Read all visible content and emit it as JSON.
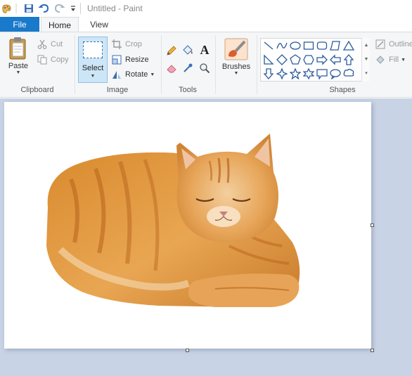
{
  "window": {
    "title": "Untitled - Paint"
  },
  "quick_access": {
    "icons": [
      "paint-app-icon",
      "save-icon",
      "undo-icon",
      "redo-icon",
      "customize-dropdown-icon"
    ]
  },
  "tabs": {
    "file": "File",
    "home": "Home",
    "view": "View"
  },
  "clipboard": {
    "paste": "Paste",
    "cut": "Cut",
    "copy": "Copy",
    "group_label": "Clipboard"
  },
  "image": {
    "select": "Select",
    "crop": "Crop",
    "resize": "Resize",
    "rotate": "Rotate",
    "group_label": "Image"
  },
  "tools": {
    "group_label": "Tools"
  },
  "brushes": {
    "label": "Brushes"
  },
  "shapes": {
    "group_label": "Shapes",
    "outline": "Outline",
    "fill": "Fill"
  },
  "canvas": {
    "content": "orange tabby cat lying down with eyes closed"
  },
  "colors": {
    "accent": "#1979ca",
    "ribbon_bg": "#f5f6f7",
    "workspace_bg": "#c8d3e5"
  }
}
